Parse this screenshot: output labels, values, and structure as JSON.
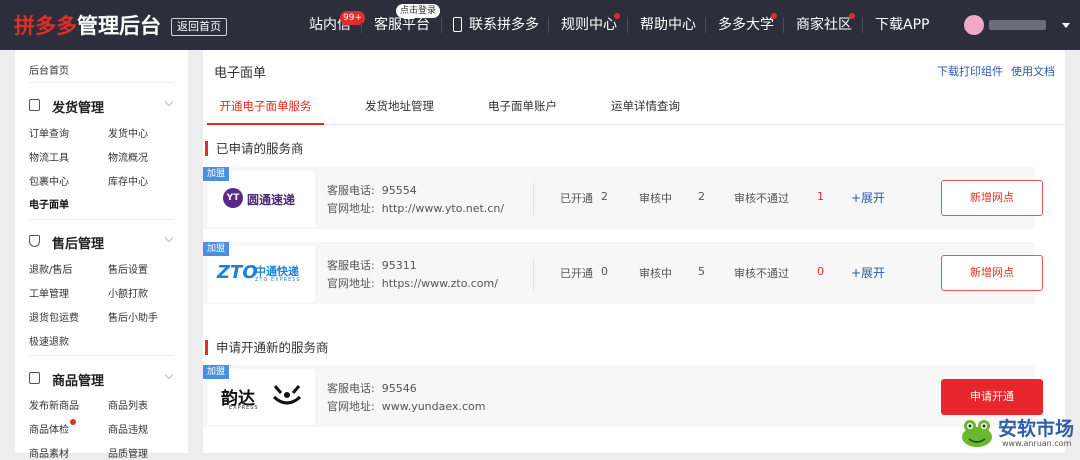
{
  "header": {
    "logo_brand": "拼多多",
    "logo_suffix": "管理后台",
    "home_button": "返回首页",
    "nav": [
      {
        "label": "站内信",
        "badge": "99+"
      },
      {
        "label": "客服平台",
        "badge": "点击登录"
      },
      {
        "label": "联系拼多多",
        "icon": "phone-icon"
      },
      {
        "label": "规则中心",
        "dot": true
      },
      {
        "label": "帮助中心"
      },
      {
        "label": "多多大学",
        "dot": true
      },
      {
        "label": "商家社区",
        "dot": true
      },
      {
        "label": "下载APP"
      }
    ]
  },
  "sidebar": {
    "home": "后台首页",
    "groups": [
      {
        "title": "发货管理",
        "icon": "document-icon",
        "items": [
          "订单查询",
          "发货中心",
          "物流工具",
          "物流概况",
          "包裹中心",
          "库存中心",
          "电子面单"
        ]
      },
      {
        "title": "售后管理",
        "icon": "shield-icon",
        "items": [
          "退款/售后",
          "售后设置",
          "工单管理",
          "小额打款",
          "退货包运费",
          "售后小助手",
          "极速退款"
        ]
      },
      {
        "title": "商品管理",
        "icon": "box-icon",
        "items": [
          "发布新商品",
          "商品列表",
          "商品体检",
          "商品违规",
          "商品素材",
          "品质管理"
        ]
      }
    ]
  },
  "main": {
    "title": "电子面单",
    "links": [
      "下载打印组件",
      "使用文档"
    ],
    "tabs": [
      "开通电子面单服务",
      "发货地址管理",
      "电子面单账户",
      "运单详情查询"
    ],
    "section_applied": "已申请的服务商",
    "section_new": "申请开通新的服务商",
    "phone_label": "客服电话:",
    "site_label": "官网地址:",
    "join_badge": "加盟",
    "stat_labels": {
      "open": "已开通",
      "review": "审核中",
      "rejected": "审核不通过"
    },
    "expand": "+展开",
    "add_button": "新增网点",
    "apply_button": "申请开通",
    "applied": [
      {
        "name": "圆通速递",
        "logo_mark": "YT",
        "phone": "95554",
        "site": "http://www.yto.net.cn/",
        "open": "2",
        "review": "2",
        "rejected": "1"
      },
      {
        "name": "中通快递",
        "logo_mark": "ZTO",
        "logo_sub": "ZTO EXPRESS",
        "phone": "95311",
        "site": "https://www.zto.com/",
        "open": "0",
        "review": "5",
        "rejected": "0"
      }
    ],
    "new": [
      {
        "name": "韵达",
        "logo_sub": "EXPRESS",
        "phone": "95546",
        "site": "www.yundaex.com"
      }
    ]
  },
  "watermark": {
    "text": "安软市场",
    "url": "www.anruan.com"
  },
  "colors": {
    "topbar": "#2c2e3b",
    "accent": "#e02e24",
    "link": "#2b5aa8",
    "join": "#4a8fe0"
  }
}
